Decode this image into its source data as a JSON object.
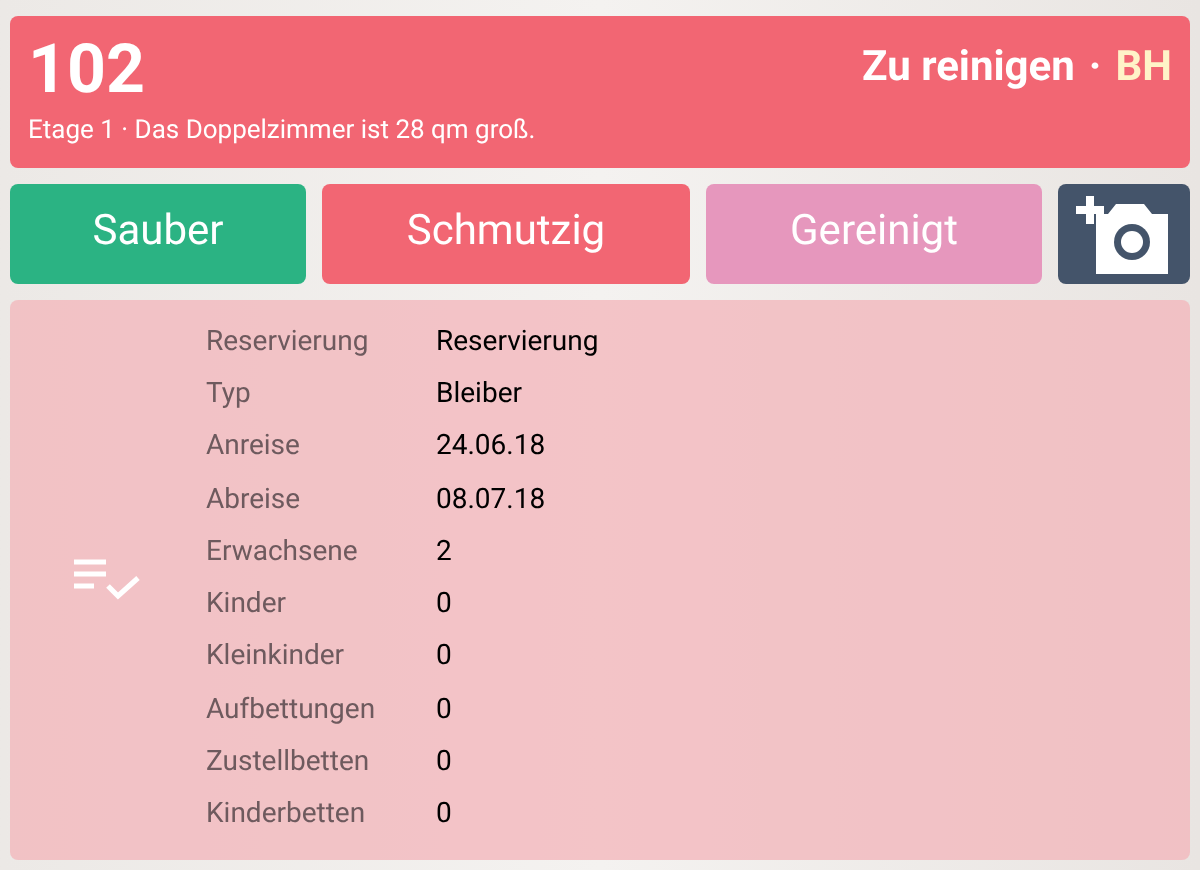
{
  "room": {
    "number": "102",
    "subtitle": "Etage 1 · Das Doppelzimmer ist 28 qm groß.",
    "status": "Zu reinigen",
    "separator": "·",
    "initials": "BH"
  },
  "buttons": [
    {
      "label": "Sauber",
      "color": "#2bb383"
    },
    {
      "label": "Schmutzig",
      "color": "#f26673"
    },
    {
      "label": "Gereinigt",
      "color": "#e697bd"
    }
  ],
  "details": [
    {
      "label": "Reservierung",
      "value": "Reservierung"
    },
    {
      "label": "Typ",
      "value": "Bleiber"
    },
    {
      "label": "Anreise",
      "value": "24.06.18"
    },
    {
      "label": "Abreise",
      "value": "08.07.18"
    },
    {
      "label": "Erwachsene",
      "value": "2"
    },
    {
      "label": "Kinder",
      "value": "0"
    },
    {
      "label": "Kleinkinder",
      "value": "0"
    },
    {
      "label": "Aufbettungen",
      "value": "0"
    },
    {
      "label": "Zustellbetten",
      "value": "0"
    },
    {
      "label": "Kinderbetten",
      "value": "0"
    }
  ]
}
